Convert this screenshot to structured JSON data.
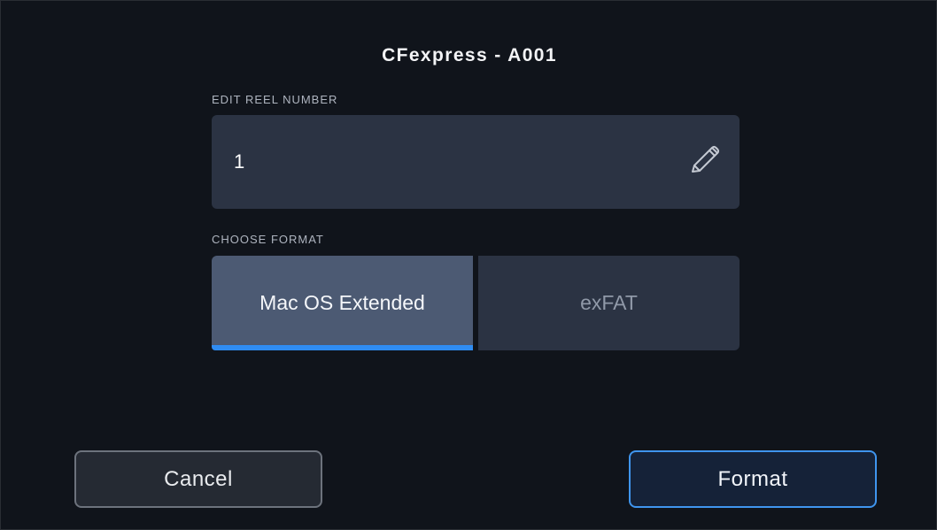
{
  "dialog": {
    "title": "CFexpress - A001"
  },
  "reel": {
    "label": "EDIT REEL NUMBER",
    "value": "1",
    "edit_icon": "pencil-icon"
  },
  "format": {
    "label": "CHOOSE FORMAT",
    "options": [
      {
        "label": "Mac OS Extended",
        "selected": true
      },
      {
        "label": "exFAT",
        "selected": false
      }
    ]
  },
  "actions": {
    "cancel_label": "Cancel",
    "format_label": "Format"
  },
  "colors": {
    "background": "#10141b",
    "field": "#2b3343",
    "selected_segment": "#4c5a73",
    "accent": "#2f8cf2"
  }
}
